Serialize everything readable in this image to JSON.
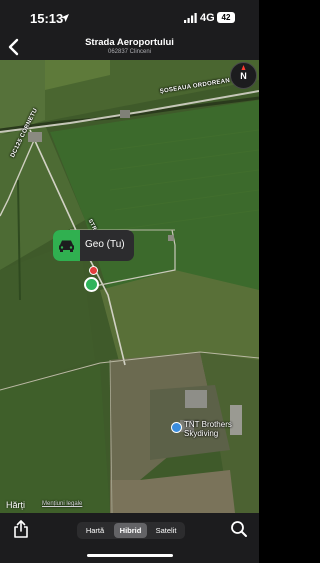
{
  "status_bar": {
    "time": "15:13",
    "network": "4G",
    "battery": "42",
    "icons": [
      "location-arrow-icon",
      "signal-icon"
    ]
  },
  "nav": {
    "title": "Strada Aeroportului",
    "subtitle": "062837 Clinceni",
    "back_icon": "chevron-left-icon"
  },
  "map": {
    "view_mode": "Hibrid",
    "compass_letter": "N",
    "road_labels": {
      "ordoreanu": "ȘOSEAUA ORDOREAN",
      "cornetu": "DC125 CORNETU",
      "str": "STR"
    },
    "user_location": {
      "label": "Geo (Tu)",
      "icon": "car-icon"
    },
    "poi": {
      "name": "TNT Brothers Skydiving",
      "icon": "location-pin-icon"
    },
    "attribution": {
      "logo": "Hărți",
      "legal": "Mențiuni legale"
    }
  },
  "bottom_bar": {
    "segments": [
      "Hartă",
      "Hibrid",
      "Satelit"
    ],
    "selected_segment": "Hibrid",
    "icons": [
      "share-icon",
      "search-icon"
    ]
  }
}
